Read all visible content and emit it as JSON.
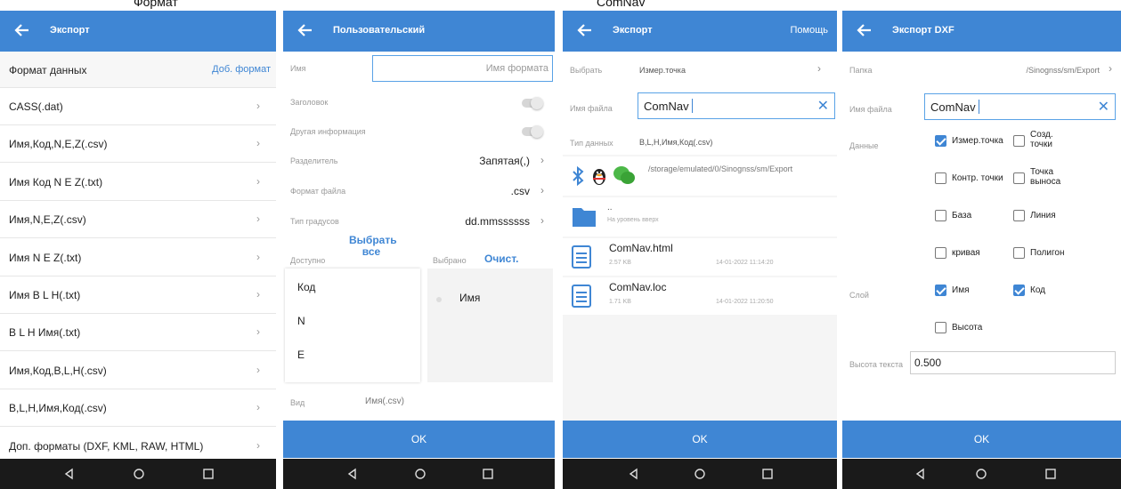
{
  "strip": {
    "left": "Формат",
    "right": "ComNav"
  },
  "panel1": {
    "title": "Экспорт",
    "data_format_label": "Формат данных",
    "add_format": "Доб. формат",
    "formats": [
      "CASS(.dat)",
      "Имя,Код,N,E,Z(.csv)",
      "Имя Код N E Z(.txt)",
      "Имя,N,E,Z(.csv)",
      "Имя N E Z(.txt)",
      "Имя B L H(.txt)",
      "B L H Имя(.txt)",
      "Имя,Код,B,L,H(.csv)",
      "B,L,H,Имя,Код(.csv)",
      "Доп. форматы (DXF, KML, RAW, HTML)"
    ]
  },
  "panel2": {
    "title": "Пользовательский",
    "name_label": "Имя",
    "name_placeholder": "Имя формата",
    "header_label": "Заголовок",
    "other_info_label": "Другая информация",
    "separator_label": "Разделитель",
    "separator_value": "Запятая(,)",
    "file_format_label": "Формат файла",
    "file_format_value": ".csv",
    "angle_label": "Тип градусов",
    "angle_value": "dd.mmssssss",
    "available_label": "Доступно",
    "select_all": "Выбрать все",
    "selected_label": "Выбрано",
    "clear": "Очист.",
    "available_items": [
      "Код",
      "N",
      "E"
    ],
    "selected_items": [
      "Имя"
    ],
    "view_label": "Вид",
    "view_value": "Имя(.csv)",
    "ok": "OK"
  },
  "panel3": {
    "title": "Экспорт",
    "help": "Помощь",
    "select_label": "Выбрать",
    "select_value": "Измер.точка",
    "filename_label": "Имя файла",
    "filename_value": "ComNav",
    "datatype_label": "Тип данных",
    "datatype_value": "B,L,H,Имя,Код(.csv)",
    "path": "/storage/emulated/0/Sinognss/sm/Export",
    "up_label": "..",
    "up_sub": "На уровень вверх",
    "files": [
      {
        "name": "ComNav.html",
        "size": "2.57 KB",
        "date": "14-01-2022 11:14:20"
      },
      {
        "name": "ComNav.loc",
        "size": "1.71 KB",
        "date": "14-01-2022 11:20:50"
      }
    ],
    "ok": "OK"
  },
  "panel4": {
    "title": "Экспорт DXF",
    "folder_label": "Папка",
    "folder_value": "/Sinognss/sm/Export",
    "filename_label": "Имя файла",
    "filename_value": "ComNav",
    "data_label": "Данные",
    "data_options": [
      {
        "label": "Измер.точка",
        "checked": true
      },
      {
        "label": "Созд. точки",
        "checked": false
      },
      {
        "label": "Контр. точки",
        "checked": false
      },
      {
        "label": "Точка выноса",
        "checked": false
      },
      {
        "label": "База",
        "checked": false
      },
      {
        "label": "Линия",
        "checked": false
      },
      {
        "label": "кривая",
        "checked": false
      },
      {
        "label": "Полигон",
        "checked": false
      }
    ],
    "layer_label": "Слой",
    "layer_options": [
      {
        "label": "Имя",
        "checked": true
      },
      {
        "label": "Код",
        "checked": true
      },
      {
        "label": "Высота",
        "checked": false
      }
    ],
    "text_height_label": "Высота текста",
    "text_height_value": "0.500",
    "ok": "OK"
  },
  "colors": {
    "accent": "#3f86d4",
    "navbar": "#1a1a1a",
    "divider": "#e6e6e6"
  }
}
